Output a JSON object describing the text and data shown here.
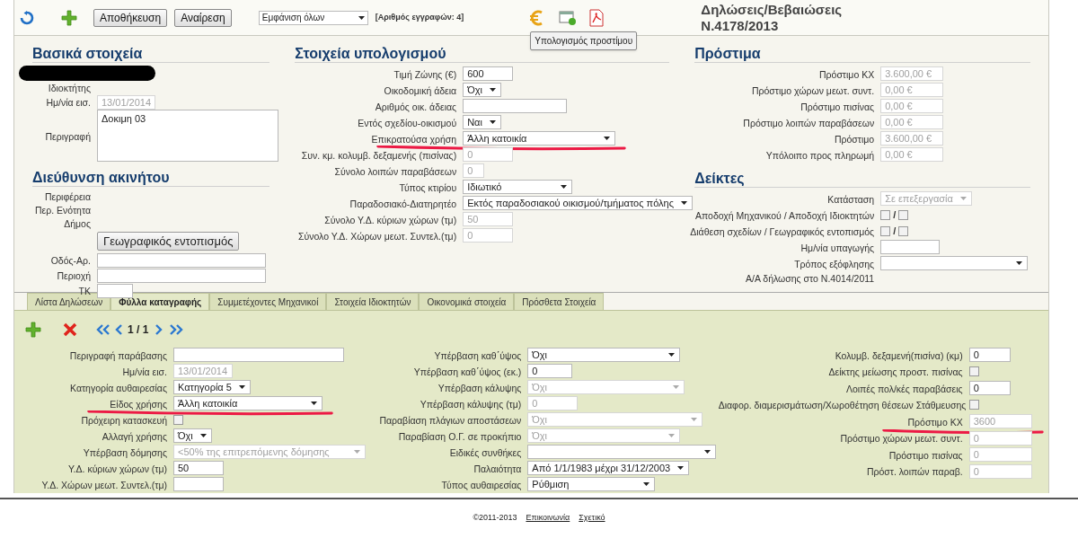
{
  "toolbar": {
    "save": "Αποθήκευση",
    "undo": "Αναίρεση",
    "filter": "Εμφάνιση όλων",
    "record_count": "[Αριθμός εγγραφών: 4]",
    "tooltip": "Υπολογισμός προστίμου",
    "title_lines": [
      "Δηλώσεις/Βεβαιώσεις",
      "Ν.4178/2013"
    ]
  },
  "upper_columns": [
    [
      {
        "title": "Βασικά στοιχεία",
        "fields": [
          {
            "label": "Ιδιοκτήτης",
            "kind": "none",
            "redacted": true
          },
          {
            "label": "Ημ/νία εισ.",
            "kind": "text",
            "value": "13/01/2014",
            "disabled": true
          },
          {
            "label": "Περιγραφή",
            "kind": "textarea",
            "value": "Δοκιμη 03",
            "disabled": false
          }
        ]
      },
      {
        "title": "Διεύθυνση ακινήτου",
        "fields": [
          {
            "label": "Περιφέρεια",
            "kind": "none"
          },
          {
            "label": "Περ. Ενότητα",
            "kind": "none"
          },
          {
            "label": "Δήμος",
            "kind": "none"
          },
          {
            "kind": "button",
            "value": "Γεωγραφικός εντοπισμός"
          },
          {
            "label": "Οδός-Αρ.",
            "kind": "text"
          },
          {
            "label": "Περιοχή",
            "kind": "text"
          },
          {
            "label": "ΤΚ",
            "kind": "text"
          }
        ]
      }
    ],
    [
      {
        "title": "Στοιχεία υπολογισμού",
        "fields": [
          {
            "label": "Τιμή Ζώνης (€)",
            "kind": "text",
            "value": "600",
            "disabled": false
          },
          {
            "label": "Οικοδομική άδεια",
            "kind": "select",
            "value": "Όχι",
            "disabled": false
          },
          {
            "label": "Αριθμός οικ. άδειας",
            "kind": "text"
          },
          {
            "label": "Εντός σχεδίου-οικισμού",
            "kind": "select",
            "value": "Ναι",
            "disabled": false
          },
          {
            "label": "Επικρατούσα χρήση",
            "kind": "select",
            "value": "Άλλη κατοικία",
            "disabled": false,
            "underlined": true
          },
          {
            "label": "Συν. κμ. κολυμβ. δεξαμενής (πισίνας)",
            "kind": "text",
            "value": "0",
            "disabled": true
          },
          {
            "label": "Σύνολο λοιπών παραβάσεων",
            "kind": "text",
            "value": "0",
            "disabled": true
          },
          {
            "label": "Τύπος κτιρίου",
            "kind": "select",
            "value": "Ιδιωτικό",
            "disabled": false
          },
          {
            "label": "Παραδοσιακό-Διατηρητέο",
            "kind": "select",
            "value": "Εκτός παραδοσιακού οικισμού/τμήματος πόλης",
            "disabled": false
          },
          {
            "label": "Σύνολο Υ.Δ. κύριων χώρων (τμ)",
            "kind": "text",
            "value": "50",
            "disabled": true
          },
          {
            "label": "Σύνολο Υ.Δ. Χώρων μεωτ. Συντελ.(τμ)",
            "kind": "text",
            "value": "0",
            "disabled": true
          }
        ]
      }
    ],
    [
      {
        "title": "Πρόστιμα",
        "fields": [
          {
            "label": "Πρόστιμο ΚΧ",
            "kind": "text",
            "value": "3.600,00 €",
            "disabled": true
          },
          {
            "label": "Πρόστιμο χώρων μεωτ. συντ.",
            "kind": "text",
            "value": "0,00 €",
            "disabled": true
          },
          {
            "label": "Πρόστιμο πισίνας",
            "kind": "text",
            "value": "0,00 €",
            "disabled": true
          },
          {
            "label": "Πρόστιμο λοιπών παραβάσεων",
            "kind": "text",
            "value": "0,00 €",
            "disabled": true
          },
          {
            "label": "Πρόστιμο",
            "kind": "text",
            "value": "3.600,00 €",
            "disabled": true
          },
          {
            "label": "Υπόλοιπο προς πληρωμή",
            "kind": "text",
            "value": "0,00 €",
            "disabled": true
          }
        ]
      },
      {
        "title": "Δείκτες",
        "fields": [
          {
            "label": "Κατάσταση",
            "kind": "select",
            "value": "Σε επεξεργασία",
            "disabled": true
          },
          {
            "label": "Αποδοχή Μηχανικού / Αποδοχή Ιδιοκτητών",
            "kind": "checkpair",
            "separator": "/",
            "checked": [
              false,
              false
            ]
          },
          {
            "label": "Διάθεση σχεδίων / Γεωγραφικός εντοπισμός",
            "kind": "checkpair",
            "separator": "/",
            "checked": [
              false,
              false
            ]
          },
          {
            "label": "Ημ/νία υπαγωγής",
            "kind": "text"
          },
          {
            "label": "Τρόπος εξόφλησης",
            "kind": "select"
          },
          {
            "label": "Α/Α δήλωσης στο Ν.4014/2011",
            "kind": "none"
          }
        ]
      }
    ]
  ],
  "tabs": [
    {
      "label": "Λίστα Δηλώσεων",
      "selected": false
    },
    {
      "label": "Φύλλα καταγραφής",
      "selected": true
    },
    {
      "label": "Συμμετέχοντες Μηχανικοί",
      "selected": false
    },
    {
      "label": "Στοιχεία Ιδιοκτητών",
      "selected": false
    },
    {
      "label": "Οικονομικά στοιχεία",
      "selected": false
    },
    {
      "label": "Πρόσθετα Στοιχεία",
      "selected": false
    }
  ],
  "pager": "1 / 1",
  "lower_columns": [
    [
      {
        "label": "Περιγραφή παράβασης",
        "kind": "text"
      },
      {
        "label": "Ημ/νία εισ.",
        "kind": "text",
        "value": "13/01/2014",
        "disabled": true
      },
      {
        "label": "Κατηγορία αυθαιρεσίας",
        "kind": "select",
        "value": "Κατηγορία 5",
        "disabled": false
      },
      {
        "label": "Είδος χρήσης",
        "kind": "select",
        "value": "Άλλη κατοικία",
        "disabled": false,
        "underlined": true
      },
      {
        "label": "Πρόχειρη κατασκευή",
        "kind": "checkbox",
        "checked": false
      },
      {
        "label": "Αλλαγή χρήσης",
        "kind": "select",
        "value": "Όχι",
        "disabled": false
      },
      {
        "label": "Υπέρβαση δόμησης",
        "kind": "select",
        "value": "<50% της επιτρεπόμενης δόμησης",
        "disabled": true
      },
      {
        "label": "Υ.Δ. κύριων χώρων (τμ)",
        "kind": "text",
        "value": "50",
        "disabled": false
      },
      {
        "label": "Υ.Δ. Χώρων μεωτ. Συντελ.(τμ)",
        "kind": "text"
      }
    ],
    [
      {
        "label": "Υπέρβαση καθ΄ύψος",
        "kind": "select",
        "value": "Όχι",
        "disabled": false
      },
      {
        "label": "Υπέρβαση καθ΄ύψος (εκ.)",
        "kind": "text",
        "value": "0",
        "disabled": false
      },
      {
        "label": "Υπέρβαση κάλυψης",
        "kind": "select",
        "value": "Όχι",
        "disabled": true
      },
      {
        "label": "Υπέρβαση κάλυψης (τμ)",
        "kind": "text",
        "value": "0",
        "disabled": true
      },
      {
        "label": "Παραβίαση πλάγιων αποστάσεων",
        "kind": "select",
        "value": "Όχι",
        "disabled": true
      },
      {
        "label": "Παραβίαση Ο.Γ. σε προκήπιο",
        "kind": "select",
        "value": "Όχι",
        "disabled": true
      },
      {
        "label": "Ειδικές συνθήκες",
        "kind": "select"
      },
      {
        "label": "Παλαιότητα",
        "kind": "select",
        "value": "Από 1/1/1983 μέχρι 31/12/2003",
        "disabled": false
      },
      {
        "label": "Τύπος αυθαιρεσίας",
        "kind": "select",
        "value": "Ρύθμιση",
        "disabled": false
      }
    ],
    [
      {
        "label": "Κολυμβ. δεξαμενή(πισίνα) (κμ)",
        "kind": "text",
        "value": "0",
        "disabled": false
      },
      {
        "label": "Δείκτης μείωσης προστ. πισίνας",
        "kind": "checkbox",
        "checked": false
      },
      {
        "label": "Λοιπές πολ/κές παραβάσεις",
        "kind": "text",
        "value": "0",
        "disabled": false
      },
      {
        "label": "Διαφορ. διαμερισμάτωση/Χωροθέτηση θέσεων Στάθμευσης",
        "kind": "checkbox",
        "checked": false
      },
      {
        "label": "Πρόστιμο ΚΧ",
        "kind": "text",
        "value": "3600",
        "disabled": true,
        "underlined": true
      },
      {
        "label": "Πρόστιμο χώρων μεωτ. συντ.",
        "kind": "text",
        "value": "0",
        "disabled": true
      },
      {
        "label": "Πρόστιμο πισίνας",
        "kind": "text",
        "value": "0",
        "disabled": true
      },
      {
        "label": "Πρόστ. λοιπών παραβ.",
        "kind": "text",
        "value": "0",
        "disabled": true
      }
    ]
  ],
  "footer": {
    "copyright": "©2011-2013",
    "links": [
      "Επικοινωνία",
      "Σχετικό"
    ]
  }
}
